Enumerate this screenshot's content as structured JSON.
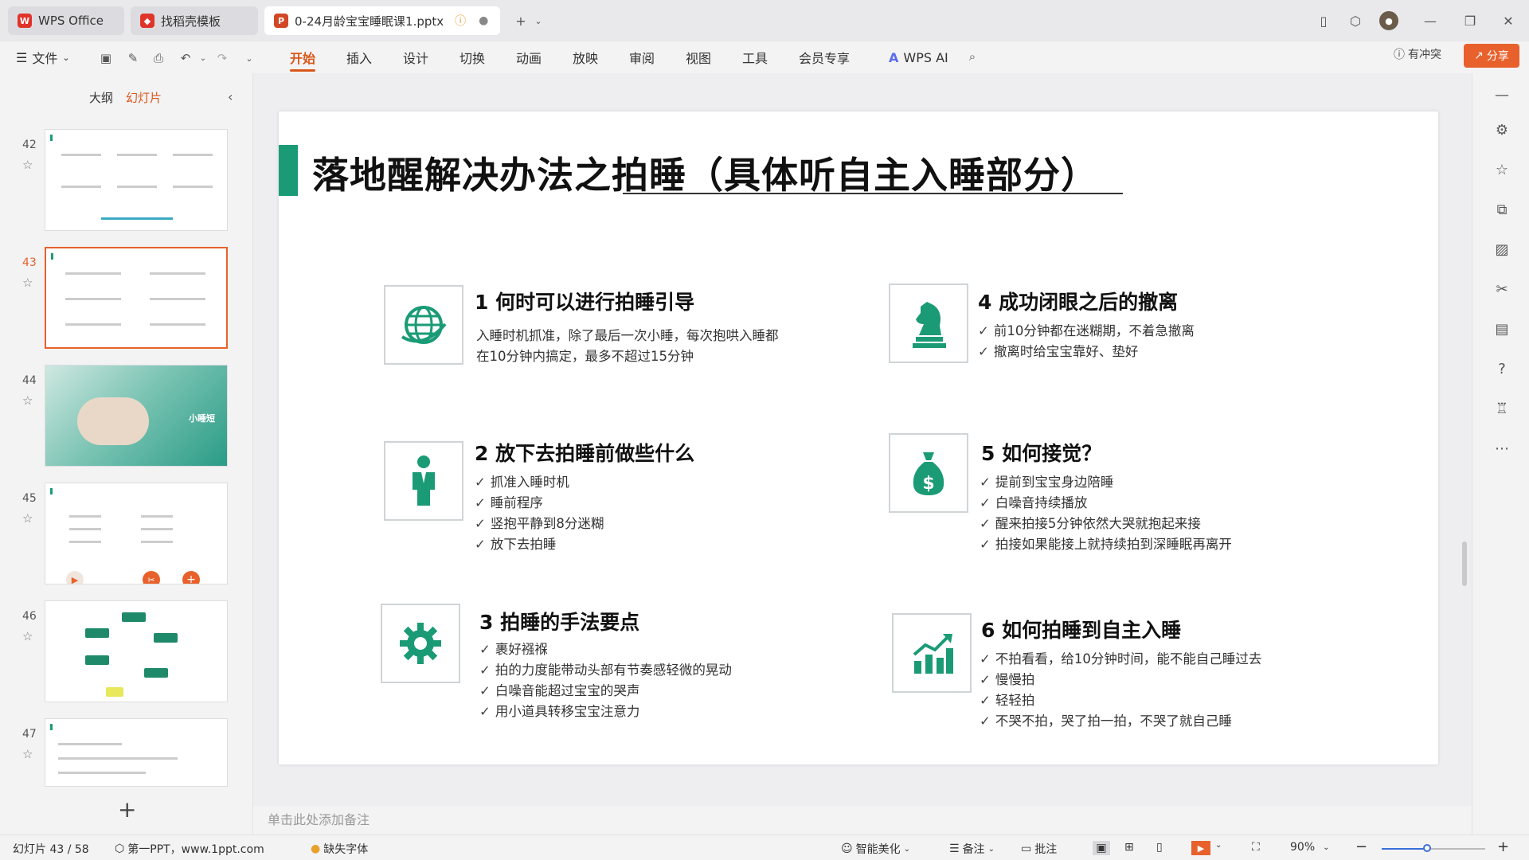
{
  "titlebar": {
    "tabs": [
      {
        "label": "WPS Office",
        "icon": "wps-logo-icon"
      },
      {
        "label": "找稻壳模板",
        "icon": "docer-icon"
      },
      {
        "label": "0-24月龄宝宝睡眠课1.pptx",
        "icon": "pptx-icon"
      }
    ],
    "new_tab_symbol": "+"
  },
  "menubar": {
    "file": "文件",
    "items": [
      "开始",
      "插入",
      "设计",
      "切换",
      "动画",
      "放映",
      "审阅",
      "视图",
      "工具",
      "会员专享"
    ],
    "active": "开始",
    "wps_ai": "WPS AI",
    "conflict": "有冲突",
    "share": "分享"
  },
  "leftpanel": {
    "tabs": [
      "大纲",
      "幻灯片"
    ],
    "active_tab": "幻灯片",
    "thumbnails": [
      {
        "num": "42"
      },
      {
        "num": "43"
      },
      {
        "num": "44",
        "label": "小睡短"
      },
      {
        "num": "45"
      },
      {
        "num": "46"
      },
      {
        "num": "47"
      }
    ]
  },
  "slide": {
    "title": "落地醒解决办法之拍睡（具体听自主入睡部分）",
    "blocks": [
      {
        "title": "1 何时可以进行拍睡引导",
        "icon": "globe-icon",
        "lines": [
          "入睡时机抓准，除了最后一次小睡，每次抱哄入睡都",
          "在10分钟内搞定，最多不超过15分钟"
        ],
        "checked": false
      },
      {
        "title": "2 放下去拍睡前做些什么",
        "icon": "person-icon",
        "lines": [
          "抓准入睡时机",
          "睡前程序",
          "竖抱平静到8分迷糊",
          "放下去拍睡"
        ],
        "checked": true
      },
      {
        "title": "3 拍睡的手法要点",
        "icon": "gear-icon",
        "lines": [
          "裹好襁褓",
          "拍的力度能带动头部有节奏感轻微的晃动",
          "白噪音能超过宝宝的哭声",
          "用小道具转移宝宝注意力"
        ],
        "checked": true
      },
      {
        "title": "4 成功闭眼之后的撤离",
        "icon": "chess-knight-icon",
        "lines": [
          "前10分钟都在迷糊期，不着急撤离",
          "撤离时给宝宝靠好、垫好"
        ],
        "checked": true
      },
      {
        "title": "5 如何接觉？",
        "icon": "money-bag-icon",
        "lines": [
          "提前到宝宝身边陪睡",
          "白噪音持续播放",
          "醒来拍接5分钟依然大哭就抱起来接",
          "拍接如果能接上就持续拍到深睡眠再离开"
        ],
        "checked": true
      },
      {
        "title": "6 如何拍睡到自主入睡",
        "icon": "growth-chart-icon",
        "lines": [
          "不拍看看，给10分钟时间，能不能自己睡过去",
          "慢慢拍",
          "轻轻拍",
          "不哭不拍，哭了拍一拍，不哭了就自己睡"
        ],
        "checked": true
      }
    ]
  },
  "notes": {
    "placeholder": "单击此处添加备注"
  },
  "statusbar": {
    "slide_counter": "幻灯片 43 / 58",
    "theme": "第一PPT，www.1ppt.com",
    "missing_font": "缺失字体",
    "beautify": "智能美化",
    "notes": "备注",
    "comments": "批注",
    "zoom": "90%"
  },
  "colors": {
    "accent": "#1a9b76",
    "brand": "#e8612c"
  }
}
